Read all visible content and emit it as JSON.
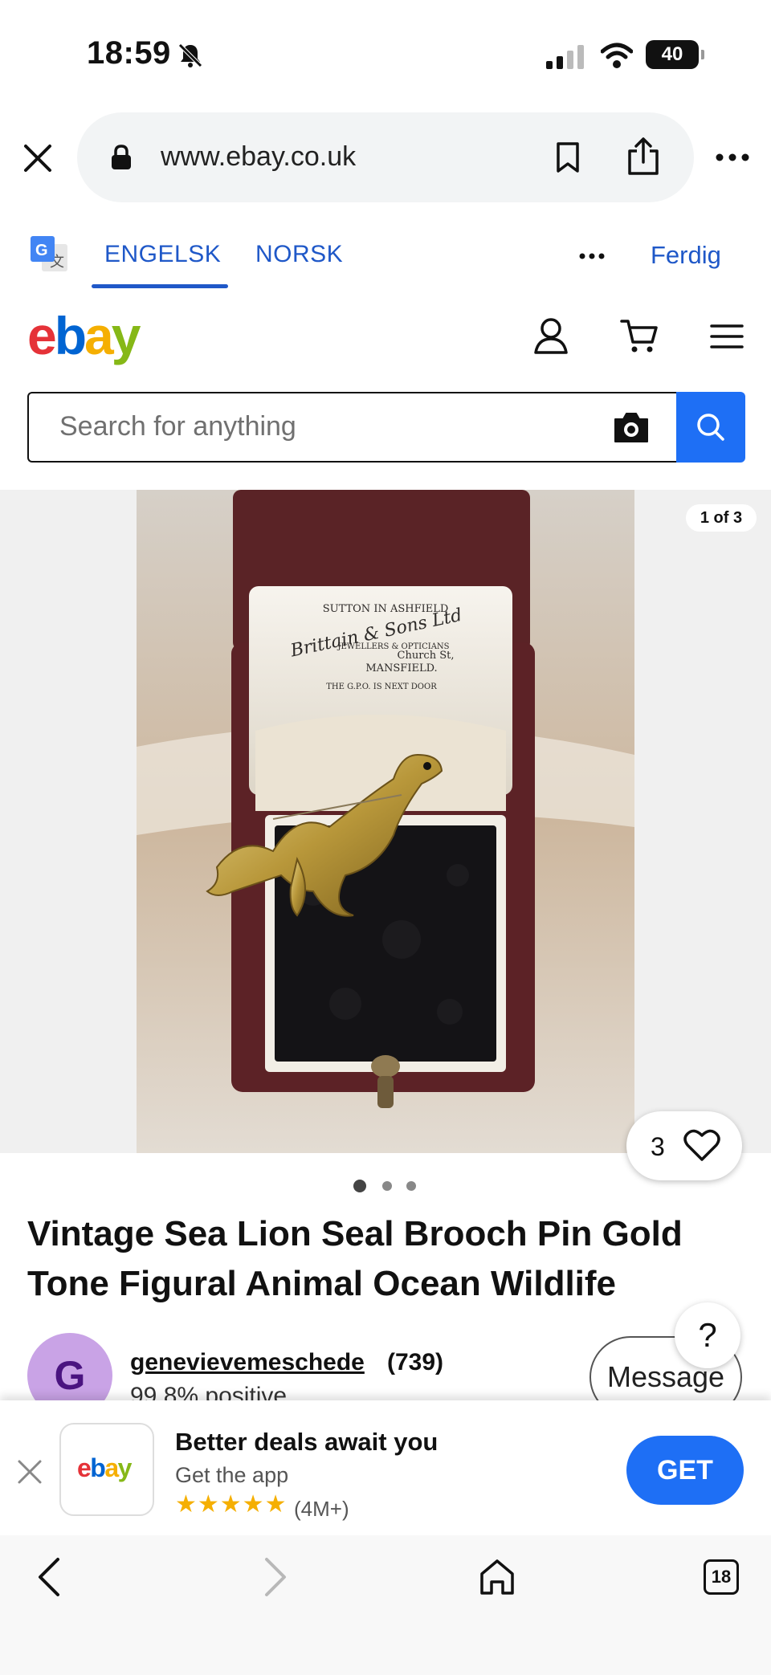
{
  "status": {
    "time": "18:59",
    "battery": "40"
  },
  "browser": {
    "url": "www.ebay.co.uk"
  },
  "translate": {
    "tab1": "ENGELSK",
    "tab2": "NORSK",
    "done": "Ferdig"
  },
  "header": {
    "logo": [
      "e",
      "b",
      "a",
      "y"
    ]
  },
  "search": {
    "placeholder": "Search for anything"
  },
  "gallery": {
    "counter": "1 of 3",
    "watch_count": "3",
    "total_images": 3,
    "current_image": 1
  },
  "listing": {
    "title": "Vintage Sea Lion Seal Brooch Pin Gold Tone Figural Animal Ocean Wildlife",
    "seller_initial": "G",
    "seller_name": "genevievemeschede",
    "seller_feedback": "(739)",
    "seller_positive": "99.8% positive",
    "message_label": "Message",
    "help_label": "?"
  },
  "box_print": {
    "line1": "SUTTON IN ASHFIELD",
    "line2": "Brittain & Sons Ltd",
    "line3": "JEWELLERS & OPTICIANS",
    "line4": "Church St,",
    "line5": "MANSFIELD.",
    "line6": "THE G.P.O. IS NEXT DOOR"
  },
  "app_banner": {
    "logo": [
      "e",
      "b",
      "a",
      "y"
    ],
    "title": "Better deals await you",
    "subtitle": "Get the app",
    "stars": "★★★★★",
    "rating": "(4M+)",
    "get_label": "GET"
  },
  "bottom_nav": {
    "tabs_count": "18"
  },
  "colors": {
    "accent_blue": "#1e6ff5",
    "link_blue": "#1f58c8",
    "ebay_red": "#e53238",
    "ebay_blue": "#0064d2",
    "ebay_yellow": "#f5af02",
    "ebay_green": "#86b817"
  }
}
